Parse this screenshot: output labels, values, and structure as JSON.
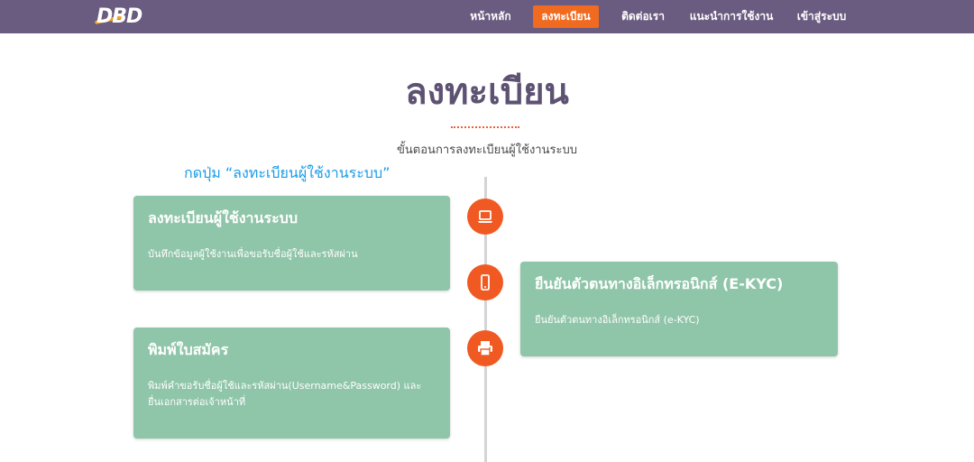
{
  "logo": {
    "text": "DBD"
  },
  "nav": {
    "items": [
      {
        "label": "หน้าหลัก",
        "active": false
      },
      {
        "label": "ลงทะเบียน",
        "active": true
      },
      {
        "label": "ติดต่อเรา",
        "active": false
      },
      {
        "label": "แนะนำการใช้งาน",
        "active": false
      },
      {
        "label": "เข้าสู่ระบบ",
        "active": false
      }
    ]
  },
  "page": {
    "title": "ลงทะเบียน",
    "subtitle": "ขั้นตอนการลงทะเบียนผู้ใช้งานระบบ",
    "hint": "กดปุ่ม “ลงทะเบียนผู้ใช้งานระบบ”"
  },
  "steps": [
    {
      "icon": "laptop-icon",
      "title": "ลงทะเบียนผู้ใช้งานระบบ",
      "description": "บันทึกข้อมูลผู้ใช้งานเพื่อขอรับชื่อผู้ใช้และรหัสผ่าน"
    },
    {
      "icon": "mobile-phone-icon",
      "title": "ยืนยันตัวตนทางอิเล็กทรอนิกส์ (E-KYC)",
      "description": "ยืนยันตัวตนทางอิเล็กทรอนิกส์ (e-KYC)"
    },
    {
      "icon": "printer-icon",
      "title": "พิมพ์ใบสมัคร",
      "description_line1": "พิมพ์คำขอรับชื่อผู้ใช้และรหัสผ่าน(Username&Password) และ",
      "description_line2": "ยื่นเอกสารต่อเจ้าหน้าที่"
    }
  ],
  "colors": {
    "navbar": "#6a5b80",
    "accent": "#f06a20",
    "card": "#8fc5a8",
    "title": "#5e5273",
    "hint": "#1a9be8"
  }
}
